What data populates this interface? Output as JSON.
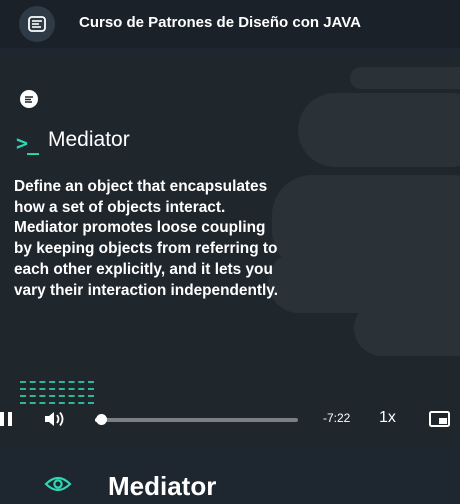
{
  "header": {
    "course_title": "Curso de Patrones de Diseño con JAVA",
    "badge_icon": "course-list-icon"
  },
  "video": {
    "slide": {
      "logo_icon": "platzi-logo-icon",
      "prompt_symbol": ">_",
      "title": "Mediator",
      "body": "Define an object that encapsulates how a set of objects interact. Mediator promotes loose coupling by keeping objects from referring to each other explicitly, and it lets you vary their interaction independently."
    },
    "controls": {
      "time_remaining": "-7:22",
      "speed": "1x",
      "progress_fraction": 0.03,
      "icons": [
        "pause-icon",
        "volume-icon",
        "picture-in-picture-icon"
      ]
    }
  },
  "lesson": {
    "title": "Mediator",
    "status_icon": "eye-icon"
  },
  "colors": {
    "accent": "#2fd6b4",
    "background": "#1e2630",
    "topbar": "#1a2129"
  }
}
